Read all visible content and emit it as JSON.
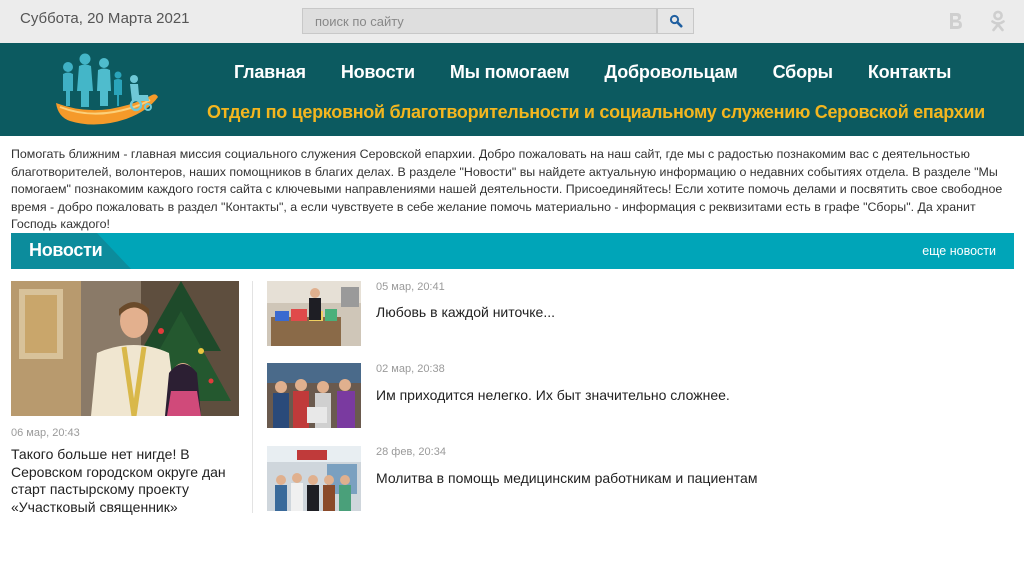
{
  "topbar": {
    "date": "Суббота, 20 Марта 2021",
    "search_placeholder": "поиск по сайту",
    "social": [
      "vk-icon",
      "odnoklassniki-icon"
    ]
  },
  "header": {
    "nav": [
      {
        "label": "Главная"
      },
      {
        "label": "Новости"
      },
      {
        "label": "Мы помогаем"
      },
      {
        "label": "Добровольцам"
      },
      {
        "label": "Сборы"
      },
      {
        "label": "Контакты"
      }
    ],
    "subtitle": "Отдел по церковной благотворительности и социальному служению Серовской епархии"
  },
  "intro": "Помогать ближним - главная миссия социального служения Серовской епархии. Добро пожаловать на наш сайт, где мы с радостью познакомим вас с деятельностью благотворителей, волонтеров, наших помощников в благих делах. В разделе \"Новости\" вы найдете актуальную информацию о недавних событиях отдела. В разделе \"Мы помогаем\" познакомим каждого гостя сайта с ключевыми направлениями нашей деятельности. Присоединяйтесь! Если хотите помочь делами и посвятить свое свободное время - добро пожаловать в раздел \"Контакты\", а если чувствуете в себе желание помочь материально - информация с реквизитами есть в графе \"Сборы\". Да хранит Господь каждого!",
  "news": {
    "title": "Новости",
    "more_label": "еще новости",
    "featured": {
      "date": "06 мар, 20:43",
      "title": "Такого больше нет нигде! В Серовском городском округе дан старт пастырскому проекту «Участковый священник»"
    },
    "items": [
      {
        "date": "05 мар, 20:41",
        "title": "Любовь в каждой ниточке..."
      },
      {
        "date": "02 мар, 20:38",
        "title": "Им приходится нелегко. Их быт значительно сложнее."
      },
      {
        "date": "28 фев, 20:34",
        "title": "Молитва в помощь медицинским работникам и пациентам"
      }
    ]
  },
  "colors": {
    "header_bg": "#0c5a60",
    "accent_teal": "#00a5b8",
    "subtitle_gold": "#f3b61f",
    "topbar_bg": "#ececec"
  }
}
